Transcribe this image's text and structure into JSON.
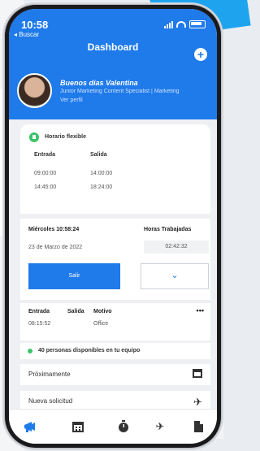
{
  "status": {
    "time": "10:58",
    "back_label": "◂ Buscar"
  },
  "header": {
    "title": "Dashboard",
    "add_icon": "plus-icon"
  },
  "profile": {
    "greeting": "Buenos días Valentina",
    "role": "Junior Marketing Content Specialist | Marketing",
    "link": "Ver perfil"
  },
  "schedule": {
    "label": "Horario flexible",
    "columns": [
      "Entrada",
      "Salida"
    ],
    "rows": [
      {
        "entrada": "09:00:00",
        "salida": "14:00:00"
      },
      {
        "entrada": "14:45:00",
        "salida": "18:24:00"
      }
    ]
  },
  "work": {
    "date_title": "Miércoles 10:58:24",
    "hours_title": "Horas Trabajadas",
    "date": "23 de Marzo de 2022",
    "hours": "02:42:32",
    "exit_label": "Salir",
    "dropdown_icon": "chevron-down-icon"
  },
  "log": {
    "columns": [
      "Entrada",
      "Salida",
      "Motivo"
    ],
    "row": {
      "entrada": "08:15:52",
      "salida": "",
      "motivo": "Office"
    },
    "more": "•••"
  },
  "team": {
    "text": "40 personas disponibles en tu equipo"
  },
  "lists": [
    {
      "label": "Próximamente",
      "icon": "calendar-icon"
    },
    {
      "label": "Nueva solicitud",
      "icon": "plane-icon"
    }
  ],
  "tabs": [
    "megaphone-icon",
    "calendar-icon",
    "stopwatch-icon",
    "plane-icon",
    "document-icon"
  ],
  "colors": {
    "primary": "#1f7aea",
    "success": "#3cc36b"
  }
}
